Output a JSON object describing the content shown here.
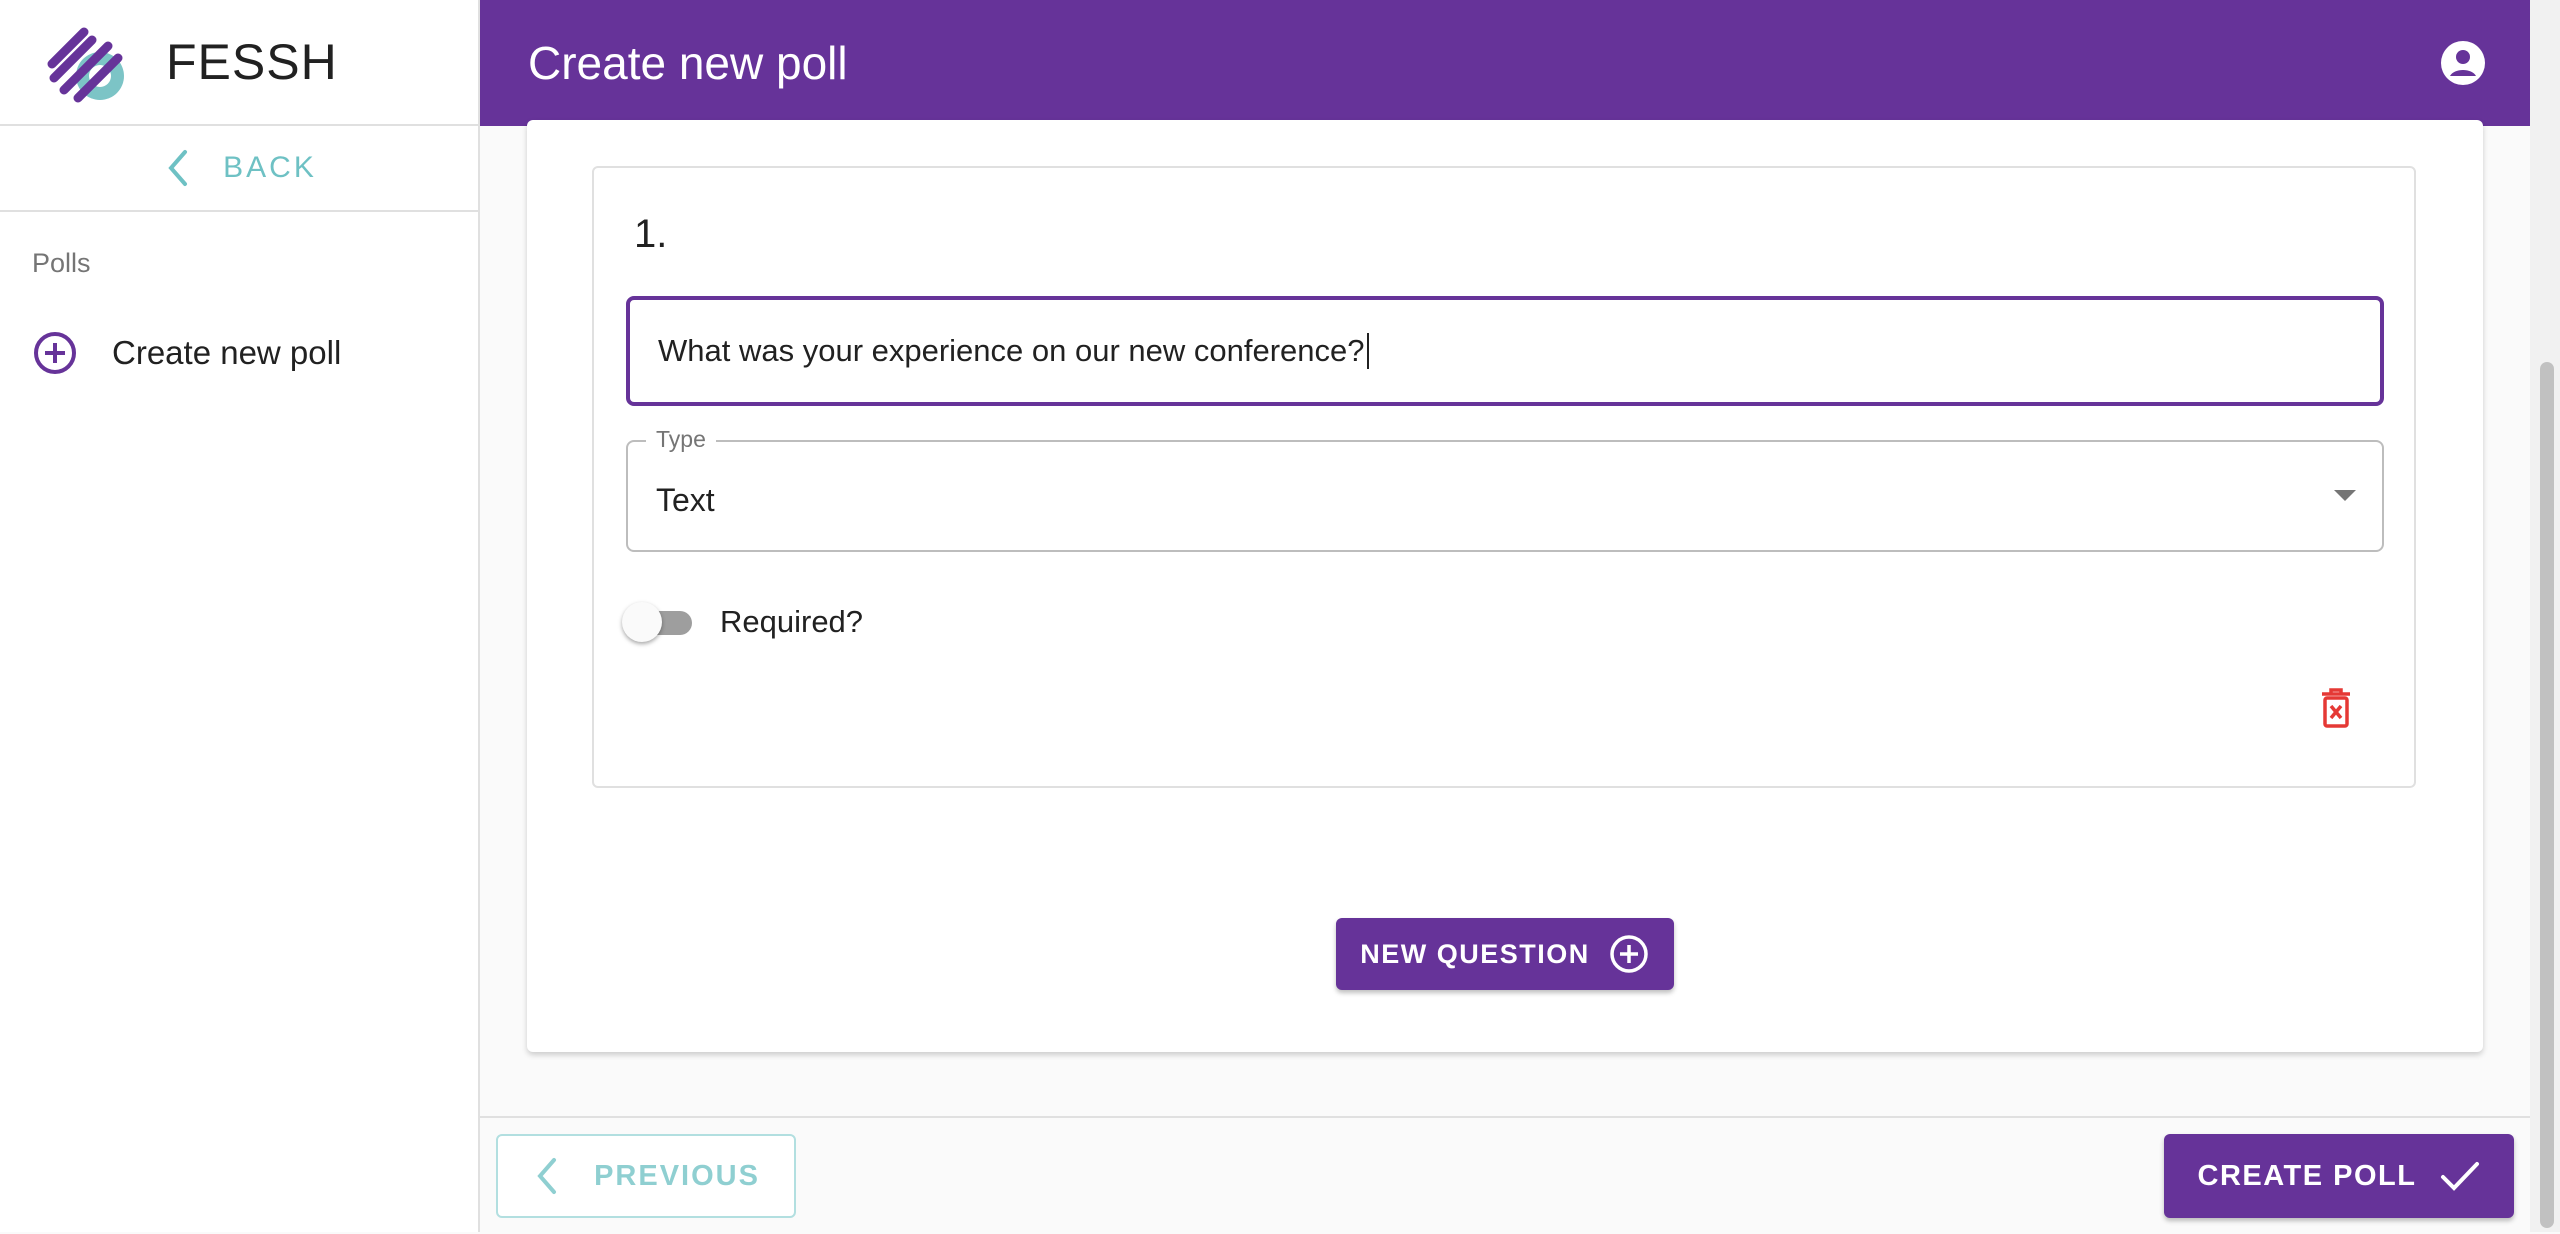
{
  "brand": {
    "name": "FESSH",
    "logo_icon": "fessh-logo-icon"
  },
  "sidebar": {
    "back_label": "BACK",
    "section_label": "Polls",
    "items": [
      {
        "label": "Create new poll",
        "icon": "add-circle-icon"
      }
    ]
  },
  "header": {
    "title": "Create new poll",
    "account_icon": "account-circle-icon"
  },
  "question": {
    "number": "1.",
    "text_value": "What was your experience on our new conference?",
    "type_label": "Type",
    "type_value": "Text",
    "required_label": "Required?",
    "required": false
  },
  "actions": {
    "new_question_label": "NEW QUESTION",
    "previous_label": "PREVIOUS",
    "create_poll_label": "CREATE POLL"
  },
  "colors": {
    "primary": "#663399",
    "accent": "#6ec1c4",
    "danger": "#e53935"
  }
}
